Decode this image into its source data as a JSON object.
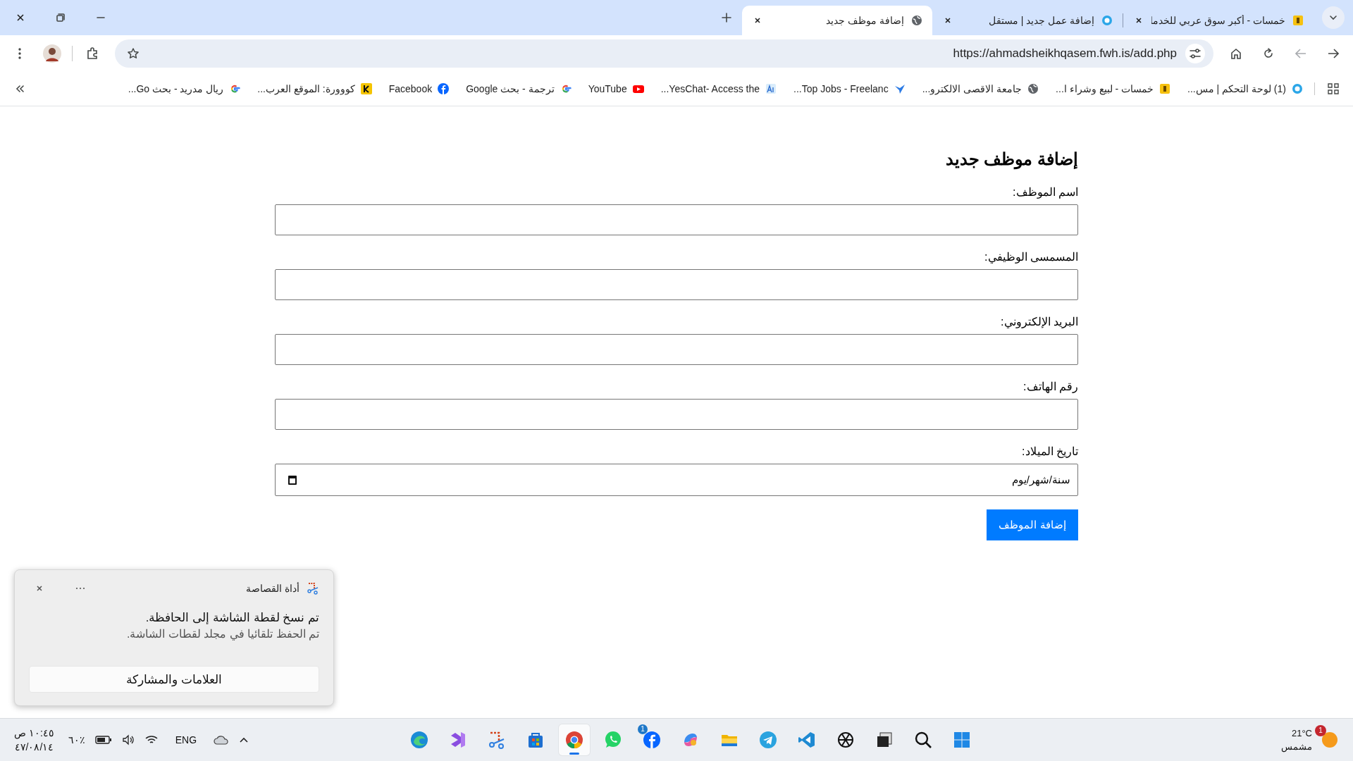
{
  "tabs": [
    {
      "title": "خمسات - أكبر سوق عربي للخدما",
      "selected": false
    },
    {
      "title": "إضافة عمل جديد | مستقل",
      "selected": false
    },
    {
      "title": "إضافة موظف جديد",
      "selected": true
    }
  ],
  "toolbar": {
    "url": "https://ahmadsheikhqasem.fwh.is/add.php",
    "forward": {
      "disabled": true
    }
  },
  "bookmarks": [
    {
      "title": "(1) لوحة التحكم | مس..."
    },
    {
      "title": "خمسات - لبيع وشراء ا..."
    },
    {
      "title": "جامعة الاقصى الالكترو..."
    },
    {
      "title": "Top Jobs - Freelanc..."
    },
    {
      "title": "YesChat- Access the..."
    },
    {
      "title": "YouTube"
    },
    {
      "title": "ترجمة - بحث Google"
    },
    {
      "title": "Facebook"
    },
    {
      "title": "كووورة: الموقع العرب..."
    },
    {
      "title": "ريال مدريد - بحث Go..."
    }
  ],
  "form": {
    "title": "إضافة موظف جديد",
    "fields": [
      {
        "label": "اسم الموظف:",
        "kind": "text"
      },
      {
        "label": "المسمسى الوظيفي:",
        "kind": "text"
      },
      {
        "label": "البريد الإلكتروني:",
        "kind": "text"
      },
      {
        "label": "رقم الهاتف:",
        "kind": "text"
      },
      {
        "label": "تاريخ الميلاد:",
        "kind": "date",
        "placeholder": "سنة/شهر/يوم"
      }
    ],
    "submit": "إضافة الموظف"
  },
  "notification": {
    "app": "أداة القصاصة",
    "title": "تم نسخ لقطة الشاشة إلى الحافظة.",
    "body": "تم الحفظ تلقائيا في مجلد لقطات الشاشة.",
    "action": "العلامات والمشاركة"
  },
  "taskbar": {
    "time": "١٠:٤٥ ص",
    "date": "٤٧/٠٨/١٤",
    "battery": "٦٠٪",
    "language": "ENG",
    "apps": [
      {
        "selected": false
      },
      {
        "selected": false
      },
      {
        "selected": false
      },
      {
        "selected": false
      },
      {
        "selected": true
      },
      {
        "selected": false
      },
      {
        "selected": false,
        "badge": "1"
      },
      {
        "selected": false
      },
      {
        "selected": false
      },
      {
        "selected": false
      },
      {
        "selected": false
      },
      {
        "selected": false
      },
      {
        "selected": false
      },
      {
        "selected": false
      },
      {
        "selected": false
      }
    ],
    "weather": {
      "temperature": "21°C",
      "condition": "مشمس",
      "badge": "1"
    }
  }
}
